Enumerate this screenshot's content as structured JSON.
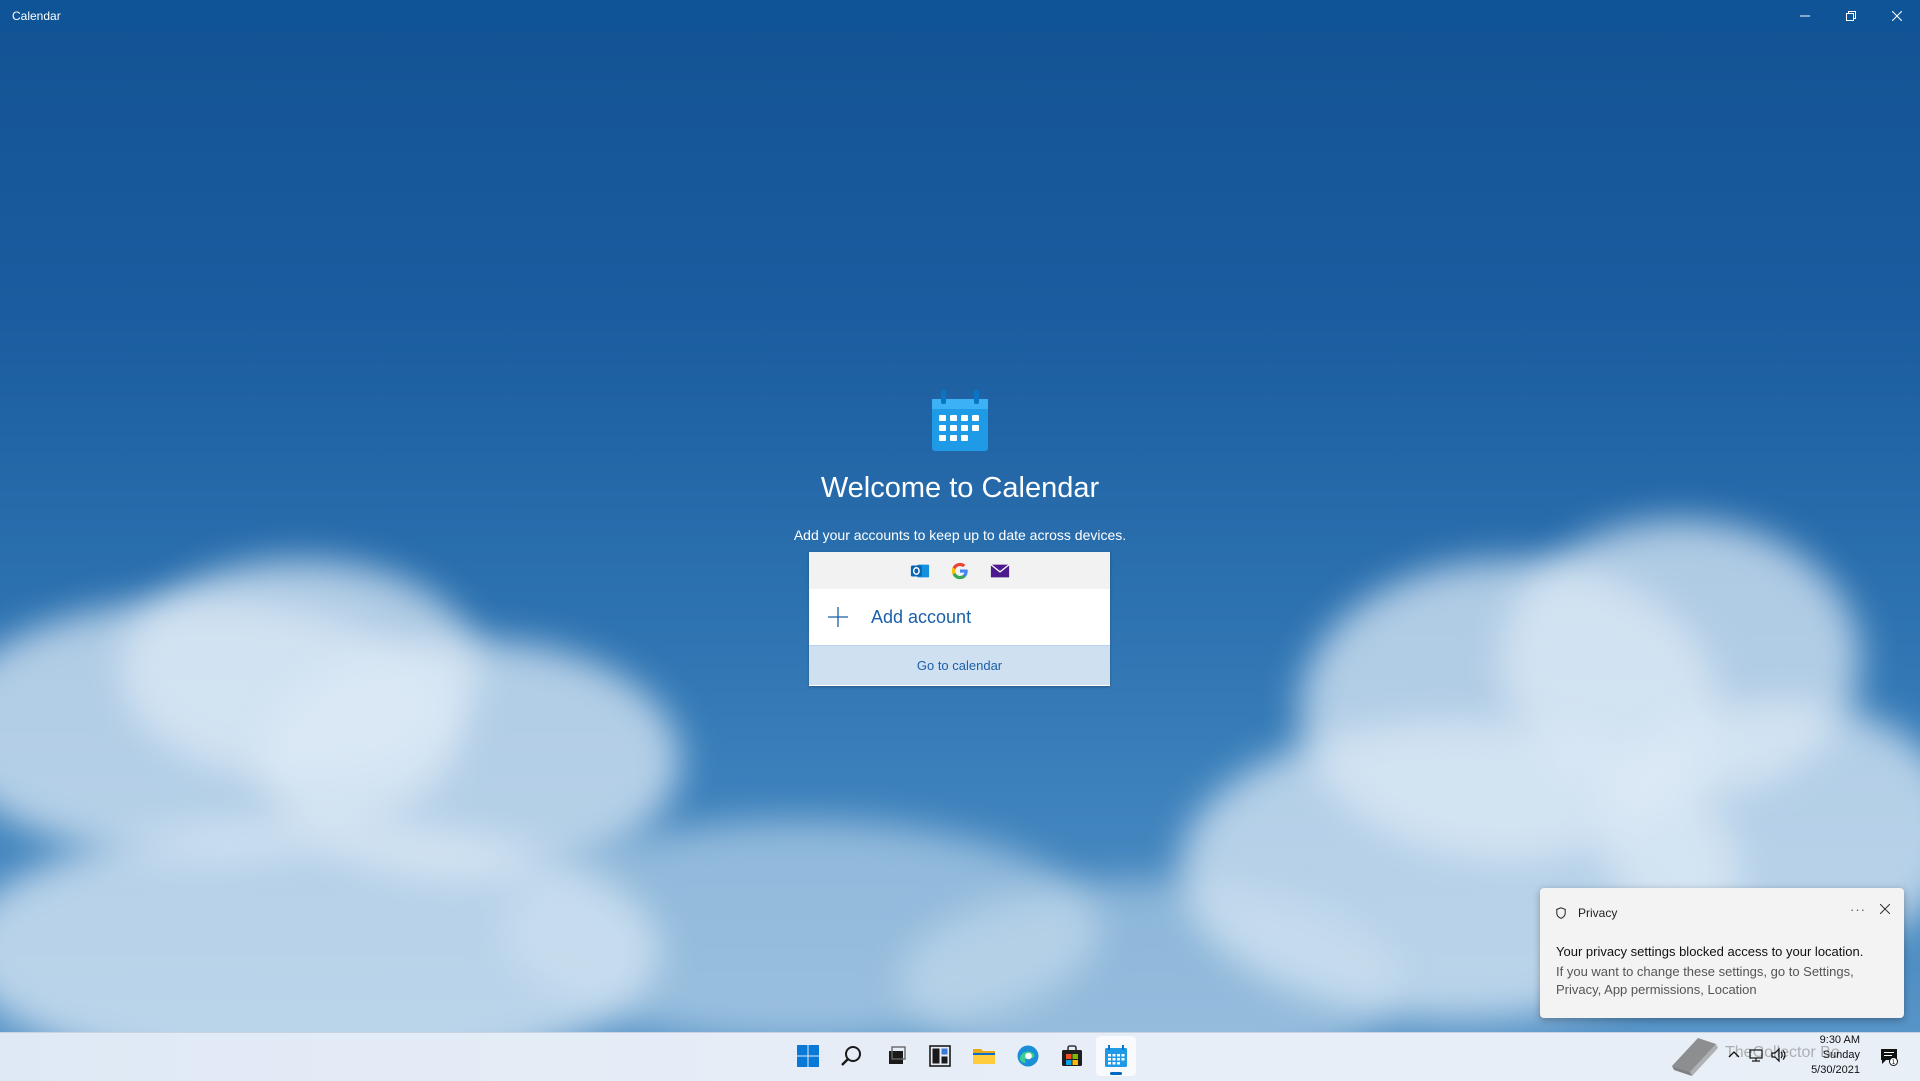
{
  "window": {
    "title": "Calendar"
  },
  "welcome": {
    "title": "Welcome to Calendar",
    "subtitle": "Add your accounts to keep up to date across devices.",
    "providers": [
      "outlook-icon",
      "google-icon",
      "mail-icon"
    ],
    "add_account_label": "Add account",
    "go_to_calendar_label": "Go to calendar"
  },
  "toast": {
    "header": "Privacy",
    "more_label": "···",
    "message": "Your privacy settings blocked access to your location.",
    "detail": "If you want to change these settings, go to Settings, Privacy, App permissions, Location"
  },
  "taskbar": {
    "apps": [
      "start-icon",
      "search-icon",
      "task-view-icon",
      "widgets-icon",
      "file-explorer-icon",
      "edge-icon",
      "store-icon",
      "calendar-icon"
    ],
    "active_app": "calendar-icon"
  },
  "tray": {
    "watermark_text": "TheCollector Bo",
    "time": "9:30 AM",
    "day": "Sunday",
    "date": "5/30/2021"
  },
  "colors": {
    "titlebar": "#0f5496",
    "accent": "#1b5fa8",
    "goto_bg": "#cfe0f1"
  }
}
